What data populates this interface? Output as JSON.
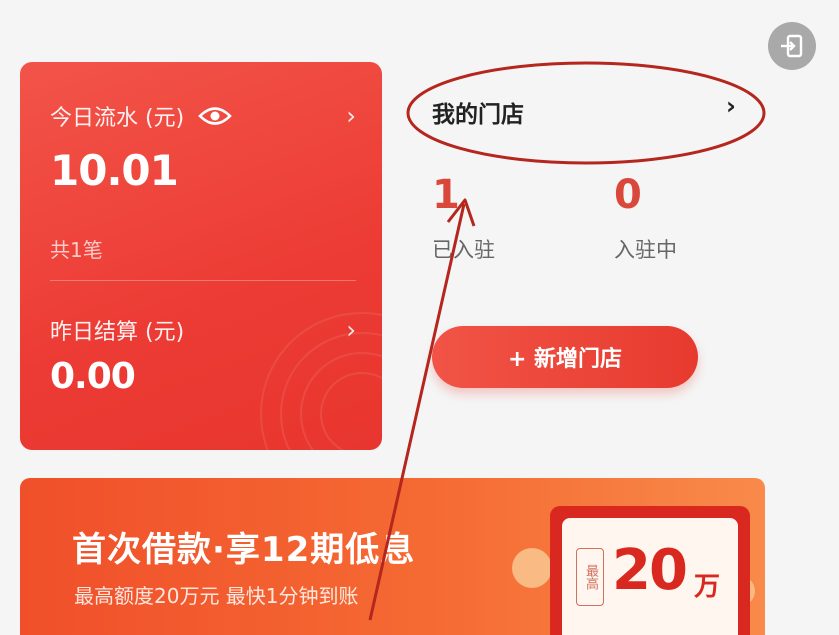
{
  "revenue": {
    "today_label": "今日流水 (元)",
    "today_value": "10.01",
    "count": "共1笔",
    "yesterday_label": "昨日结算 (元)",
    "yesterday_value": "0.00",
    "chevron": "›"
  },
  "store": {
    "title": "我的门店",
    "chevron": "›",
    "settled_count": "1",
    "settled_label": "已入驻",
    "pending_count": "0",
    "pending_label": "入驻中",
    "add_button": "+ 新增门店"
  },
  "loan": {
    "title": "首次借款·享12期低息",
    "subtitle": "最高额度20万元 最快1分钟到账",
    "badge": "最高",
    "amount": "20",
    "unit": "万"
  },
  "colors": {
    "primary_red": "#ec3b34",
    "annotation_red": "#b5271e",
    "exit_button": "#a9a9a9"
  },
  "icons": [
    "exit-icon",
    "eye-icon",
    "chevron-right-icon"
  ]
}
